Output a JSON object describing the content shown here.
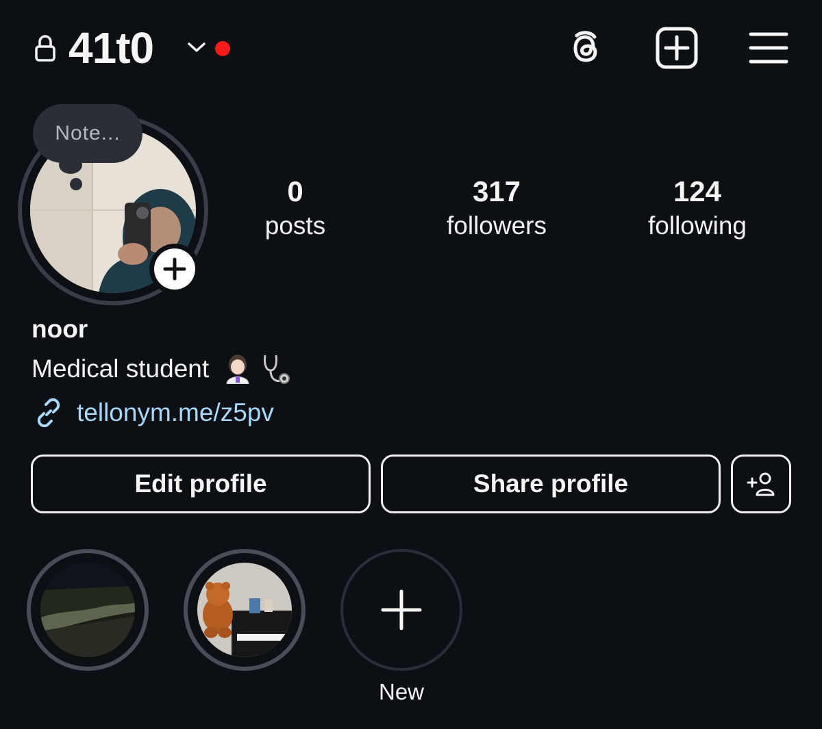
{
  "header": {
    "username": "41t0",
    "icons": [
      "lock-icon",
      "chevron-down-icon",
      "threads-icon",
      "create-icon",
      "menu-icon"
    ],
    "notification_dot_color": "#ff1a1a"
  },
  "note": {
    "placeholder": "Note..."
  },
  "stats": [
    {
      "value": "0",
      "label": "posts"
    },
    {
      "value": "317",
      "label": "followers"
    },
    {
      "value": "124",
      "label": "following"
    }
  ],
  "profile": {
    "name": "noor",
    "bio": "Medical student",
    "bio_emoji": [
      "woman-health-worker-emoji",
      "stethoscope-emoji"
    ],
    "link": "tellonym.me/z5pv",
    "link_color": "#a8d8fb"
  },
  "buttons": {
    "edit": "Edit profile",
    "share": "Share profile"
  },
  "highlights": {
    "new_label": "New"
  }
}
